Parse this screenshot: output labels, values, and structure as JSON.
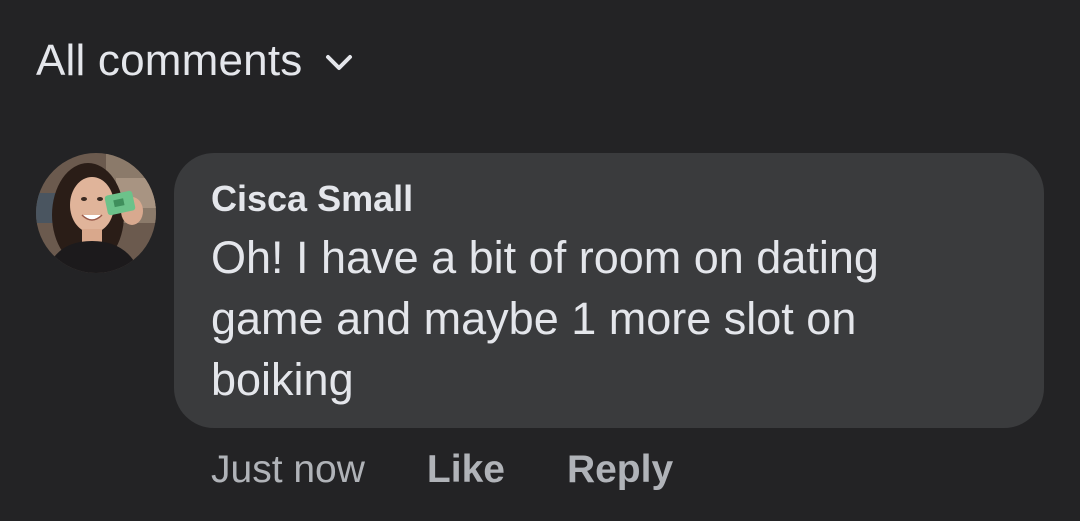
{
  "filter": {
    "label": "All comments",
    "icon": "chevron-down-icon"
  },
  "comment": {
    "author": "Cisca Small",
    "text": "Oh! I have a bit of room on dating game and maybe 1 more slot on boiking",
    "timestamp": "Just now",
    "like_label": "Like",
    "reply_label": "Reply"
  },
  "colors": {
    "background": "#232325",
    "bubble": "#3a3b3d",
    "text_primary": "#e4e6eb",
    "text_secondary": "#b0b3b8"
  }
}
